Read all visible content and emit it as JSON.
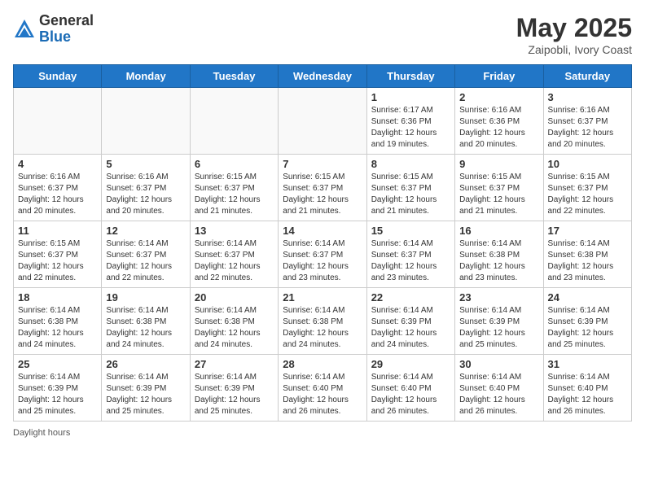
{
  "logo": {
    "general": "General",
    "blue": "Blue"
  },
  "title": "May 2025",
  "location": "Zaipobli, Ivory Coast",
  "days_of_week": [
    "Sunday",
    "Monday",
    "Tuesday",
    "Wednesday",
    "Thursday",
    "Friday",
    "Saturday"
  ],
  "footer": "Daylight hours",
  "weeks": [
    [
      {
        "day": "",
        "info": ""
      },
      {
        "day": "",
        "info": ""
      },
      {
        "day": "",
        "info": ""
      },
      {
        "day": "",
        "info": ""
      },
      {
        "day": "1",
        "info": "Sunrise: 6:17 AM\nSunset: 6:36 PM\nDaylight: 12 hours and 19 minutes."
      },
      {
        "day": "2",
        "info": "Sunrise: 6:16 AM\nSunset: 6:36 PM\nDaylight: 12 hours and 20 minutes."
      },
      {
        "day": "3",
        "info": "Sunrise: 6:16 AM\nSunset: 6:37 PM\nDaylight: 12 hours and 20 minutes."
      }
    ],
    [
      {
        "day": "4",
        "info": "Sunrise: 6:16 AM\nSunset: 6:37 PM\nDaylight: 12 hours and 20 minutes."
      },
      {
        "day": "5",
        "info": "Sunrise: 6:16 AM\nSunset: 6:37 PM\nDaylight: 12 hours and 20 minutes."
      },
      {
        "day": "6",
        "info": "Sunrise: 6:15 AM\nSunset: 6:37 PM\nDaylight: 12 hours and 21 minutes."
      },
      {
        "day": "7",
        "info": "Sunrise: 6:15 AM\nSunset: 6:37 PM\nDaylight: 12 hours and 21 minutes."
      },
      {
        "day": "8",
        "info": "Sunrise: 6:15 AM\nSunset: 6:37 PM\nDaylight: 12 hours and 21 minutes."
      },
      {
        "day": "9",
        "info": "Sunrise: 6:15 AM\nSunset: 6:37 PM\nDaylight: 12 hours and 21 minutes."
      },
      {
        "day": "10",
        "info": "Sunrise: 6:15 AM\nSunset: 6:37 PM\nDaylight: 12 hours and 22 minutes."
      }
    ],
    [
      {
        "day": "11",
        "info": "Sunrise: 6:15 AM\nSunset: 6:37 PM\nDaylight: 12 hours and 22 minutes."
      },
      {
        "day": "12",
        "info": "Sunrise: 6:14 AM\nSunset: 6:37 PM\nDaylight: 12 hours and 22 minutes."
      },
      {
        "day": "13",
        "info": "Sunrise: 6:14 AM\nSunset: 6:37 PM\nDaylight: 12 hours and 22 minutes."
      },
      {
        "day": "14",
        "info": "Sunrise: 6:14 AM\nSunset: 6:37 PM\nDaylight: 12 hours and 23 minutes."
      },
      {
        "day": "15",
        "info": "Sunrise: 6:14 AM\nSunset: 6:37 PM\nDaylight: 12 hours and 23 minutes."
      },
      {
        "day": "16",
        "info": "Sunrise: 6:14 AM\nSunset: 6:38 PM\nDaylight: 12 hours and 23 minutes."
      },
      {
        "day": "17",
        "info": "Sunrise: 6:14 AM\nSunset: 6:38 PM\nDaylight: 12 hours and 23 minutes."
      }
    ],
    [
      {
        "day": "18",
        "info": "Sunrise: 6:14 AM\nSunset: 6:38 PM\nDaylight: 12 hours and 24 minutes."
      },
      {
        "day": "19",
        "info": "Sunrise: 6:14 AM\nSunset: 6:38 PM\nDaylight: 12 hours and 24 minutes."
      },
      {
        "day": "20",
        "info": "Sunrise: 6:14 AM\nSunset: 6:38 PM\nDaylight: 12 hours and 24 minutes."
      },
      {
        "day": "21",
        "info": "Sunrise: 6:14 AM\nSunset: 6:38 PM\nDaylight: 12 hours and 24 minutes."
      },
      {
        "day": "22",
        "info": "Sunrise: 6:14 AM\nSunset: 6:39 PM\nDaylight: 12 hours and 24 minutes."
      },
      {
        "day": "23",
        "info": "Sunrise: 6:14 AM\nSunset: 6:39 PM\nDaylight: 12 hours and 25 minutes."
      },
      {
        "day": "24",
        "info": "Sunrise: 6:14 AM\nSunset: 6:39 PM\nDaylight: 12 hours and 25 minutes."
      }
    ],
    [
      {
        "day": "25",
        "info": "Sunrise: 6:14 AM\nSunset: 6:39 PM\nDaylight: 12 hours and 25 minutes."
      },
      {
        "day": "26",
        "info": "Sunrise: 6:14 AM\nSunset: 6:39 PM\nDaylight: 12 hours and 25 minutes."
      },
      {
        "day": "27",
        "info": "Sunrise: 6:14 AM\nSunset: 6:39 PM\nDaylight: 12 hours and 25 minutes."
      },
      {
        "day": "28",
        "info": "Sunrise: 6:14 AM\nSunset: 6:40 PM\nDaylight: 12 hours and 26 minutes."
      },
      {
        "day": "29",
        "info": "Sunrise: 6:14 AM\nSunset: 6:40 PM\nDaylight: 12 hours and 26 minutes."
      },
      {
        "day": "30",
        "info": "Sunrise: 6:14 AM\nSunset: 6:40 PM\nDaylight: 12 hours and 26 minutes."
      },
      {
        "day": "31",
        "info": "Sunrise: 6:14 AM\nSunset: 6:40 PM\nDaylight: 12 hours and 26 minutes."
      }
    ]
  ]
}
